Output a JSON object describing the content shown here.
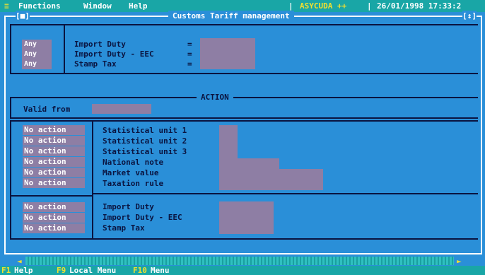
{
  "menubar": {
    "sys_icon": "≡",
    "items": [
      "Functions",
      "Window",
      "Help"
    ],
    "app_name": "ASYCUDA ++",
    "datetime": "26/01/1998 17:33:2"
  },
  "window": {
    "title": "Customs Tariff management",
    "close_box": "[■]",
    "zoom_box": "[↕]"
  },
  "upper_section": {
    "tags": [
      "Any",
      "Any",
      "Any"
    ],
    "labels": [
      "Import Duty",
      "Import Duty - EEC",
      "Stamp Tax"
    ],
    "equals": [
      "=",
      "=",
      "="
    ]
  },
  "action_section": {
    "title": "ACTION",
    "valid_from_label": "Valid from",
    "valid_from_value": "",
    "unit_actions": [
      "No action",
      "No action",
      "No action",
      "No action",
      "No action",
      "No action"
    ],
    "unit_labels": [
      "Statistical unit 1",
      "Statistical unit 2",
      "Statistical unit 3",
      "National note",
      "Market value",
      "Taxation rule"
    ],
    "duty_actions": [
      "No action",
      "No action",
      "No action"
    ],
    "duty_labels": [
      "Import Duty",
      "Import Duty - EEC",
      "Stamp Tax"
    ]
  },
  "scrollbar": {
    "left": "◄",
    "right": "►"
  },
  "statusbar": [
    {
      "key": "F1",
      "label": "Help"
    },
    {
      "key": "F9",
      "label": "Local Menu"
    },
    {
      "key": "F10",
      "label": "Menu"
    }
  ],
  "colors": {
    "background": "#2a8fd8",
    "bar": "#19a6a6",
    "field": "#8e7ea4",
    "highlight": "#f0e030"
  }
}
